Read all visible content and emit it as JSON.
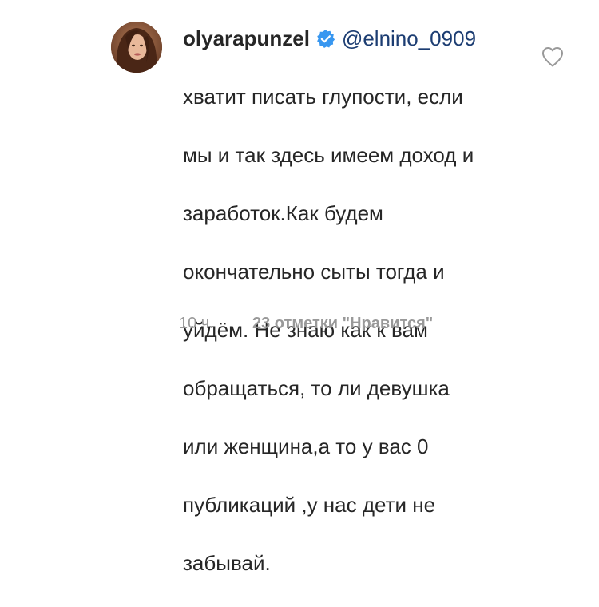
{
  "comment": {
    "username": "olyarapunzel",
    "verified": true,
    "mention": "@elnino_0909",
    "text_lines": [
      "хватит писать глупости, если",
      "мы и так здесь имеем доход и",
      "заработок.Как будем",
      "окончательно сыты тогда и",
      "уйдём. Не знаю как к вам",
      "обращаться, то ли девушка",
      "или женщина,а то у вас 0",
      "публикаций ,у нас дети не",
      "забывай."
    ],
    "time": "10 ч.",
    "likes_label": "23 отметки \"Нравится\""
  },
  "icons": {
    "avatar": "profile-photo",
    "verified": "verified-badge-icon",
    "like": "heart-outline-icon"
  },
  "colors": {
    "verified_badge": "#3897f0",
    "mention": "#1c3d72",
    "meta_text": "#999999",
    "text": "#262626"
  }
}
